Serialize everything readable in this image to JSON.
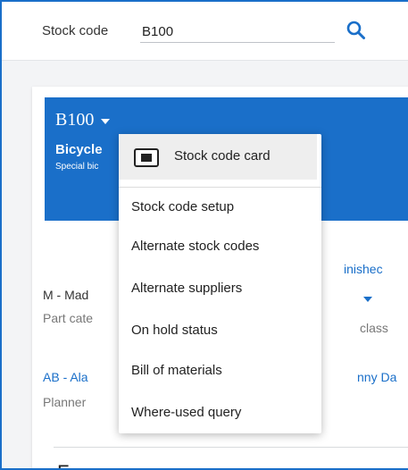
{
  "search": {
    "label": "Stock code",
    "value": "B100",
    "icon": "search-icon"
  },
  "card": {
    "header": {
      "code": "B100",
      "description": "Bicycle",
      "subtitle": "Special bic"
    },
    "fields": {
      "type_value": "M - Mad",
      "type_label": "Part cate",
      "class_value": "inishec",
      "class_label": "class",
      "planner_value": "AB - Ala",
      "planner_label": "Planner",
      "buyer_value": "nny Da"
    },
    "bottom_title": "F ..."
  },
  "menu": {
    "top_item": "Stock code card",
    "items": [
      "Stock code setup",
      "Alternate stock codes",
      "Alternate suppliers",
      "On hold status",
      "Bill of materials",
      "Where-used query"
    ]
  },
  "colors": {
    "accent": "#1a6fc9",
    "frame_border": "#1a6fc9",
    "menu_highlight": "#eeeeee"
  }
}
